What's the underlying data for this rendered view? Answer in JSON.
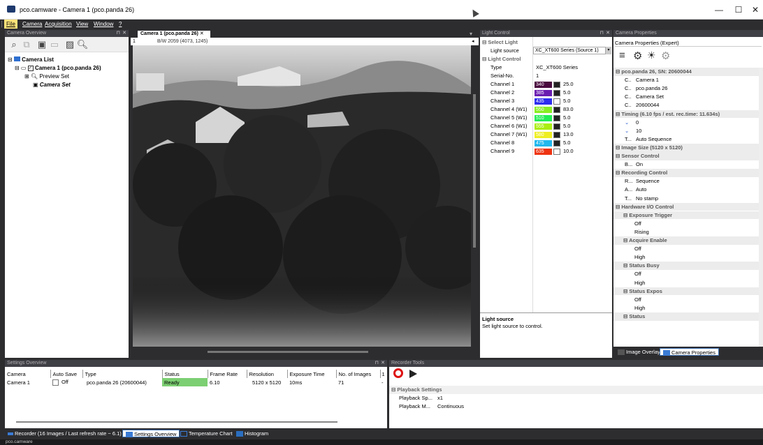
{
  "window": {
    "title": "pco.camware - Camera 1 (pco.panda 26)",
    "min": "—",
    "max": "☐",
    "close": "✕"
  },
  "menu": [
    {
      "label": "File"
    },
    {
      "label": "Camera"
    },
    {
      "label": "Acquisition"
    },
    {
      "label": "View"
    },
    {
      "label": "Window"
    },
    {
      "label": "?"
    }
  ],
  "camera_overview": {
    "title": "Camera Overview",
    "tree": {
      "root": "Camera List",
      "camera": "Camera 1 (pco.panda 26)",
      "preview": "Preview Set",
      "camset": "Camera Set"
    }
  },
  "image_view": {
    "tab": "Camera 1 (pco.panda 26)",
    "info": "B/W  2059 (4073, 1245)",
    "ruler_left": "1"
  },
  "light_control": {
    "title": "Light Control",
    "sections": {
      "select": "Select Light",
      "control": "Light Control"
    },
    "light_source_label": "Light source",
    "light_source_value": "XC_XT600 Series (Source 1)",
    "type_label": "Type",
    "type_value": "XC_XT600 Series",
    "serial_label": "Serial-No.",
    "serial_value": "1",
    "channels": [
      {
        "name": "Channel 1",
        "wl": "340",
        "color": "#4a0a3e",
        "fill": "#222222",
        "value": "25.0"
      },
      {
        "name": "Channel 2",
        "wl": "385",
        "color": "#6a1db0",
        "fill": "#222222",
        "value": "5.0"
      },
      {
        "name": "Channel 3",
        "wl": "435",
        "color": "#2d2dee",
        "fill": "#ffffff",
        "value": "5.0"
      },
      {
        "name": "Channel 4 (W1)",
        "wl": "550",
        "color": "#88ee22",
        "fill": "#222222",
        "value": "83.0"
      },
      {
        "name": "Channel 5 (W1)",
        "wl": "510",
        "color": "#22ee55",
        "fill": "#222222",
        "value": "5.0"
      },
      {
        "name": "Channel 6 (W1)",
        "wl": "555",
        "color": "#aaee11",
        "fill": "#222222",
        "value": "5.0"
      },
      {
        "name": "Channel 7 (W1)",
        "wl": "580",
        "color": "#eeee22",
        "fill": "#222222",
        "value": "13.0"
      },
      {
        "name": "Channel 8",
        "wl": "475",
        "color": "#22b8ee",
        "fill": "#222222",
        "value": "5.0"
      },
      {
        "name": "Channel 9",
        "wl": "635",
        "color": "#ee3311",
        "fill": "#ffffff",
        "value": "10.0"
      }
    ],
    "help_title": "Light source",
    "help_text": "Set light source to control."
  },
  "camera_properties": {
    "title": "Camera Properties",
    "dropdown": "Camera Properties (Expert)",
    "rows": [
      {
        "k": "",
        "v": "pco.panda 26, SN: 20600044",
        "kind": "sect"
      },
      {
        "k": "C..",
        "v": "Camera 1",
        "kind": "row"
      },
      {
        "k": "C..",
        "v": "pco.panda 26",
        "kind": "row"
      },
      {
        "k": "C..",
        "v": "Camera Set",
        "kind": "row"
      },
      {
        "k": "C..",
        "v": "20600044",
        "kind": "row"
      },
      {
        "k": "",
        "v": "Timing (6.10 fps / est. rec.time: 11.634s)",
        "kind": "sect"
      },
      {
        "k": "⌄",
        "v": "0",
        "kind": "row"
      },
      {
        "k": "⌄",
        "v": "10",
        "kind": "row"
      },
      {
        "k": "T...",
        "v": "Auto Sequence",
        "kind": "row"
      },
      {
        "k": "",
        "v": "Image Size (5120 x 5120)",
        "kind": "sect"
      },
      {
        "k": "",
        "v": "Sensor Control",
        "kind": "sect"
      },
      {
        "k": "B...",
        "v": "On",
        "kind": "row"
      },
      {
        "k": "",
        "v": "Recording Control",
        "kind": "sect"
      },
      {
        "k": "R...",
        "v": "Sequence",
        "kind": "row"
      },
      {
        "k": "A...",
        "v": "Auto",
        "kind": "row"
      },
      {
        "k": "T...",
        "v": "No stamp",
        "kind": "row"
      },
      {
        "k": "",
        "v": "Hardware I/O Control",
        "kind": "sect"
      },
      {
        "k": "",
        "v": "Exposure Trigger",
        "kind": "sub"
      },
      {
        "k": "",
        "v": "Off",
        "kind": "val"
      },
      {
        "k": "",
        "v": "Rising",
        "kind": "val"
      },
      {
        "k": "",
        "v": "Acquire Enable",
        "kind": "sub"
      },
      {
        "k": "",
        "v": "Off",
        "kind": "val"
      },
      {
        "k": "",
        "v": "High",
        "kind": "val"
      },
      {
        "k": "",
        "v": "Status Busy",
        "kind": "sub"
      },
      {
        "k": "",
        "v": "Off",
        "kind": "val"
      },
      {
        "k": "",
        "v": "High",
        "kind": "val"
      },
      {
        "k": "",
        "v": "Status Expos",
        "kind": "sub"
      },
      {
        "k": "",
        "v": "Off",
        "kind": "val"
      },
      {
        "k": "",
        "v": "High",
        "kind": "val"
      },
      {
        "k": "",
        "v": "Status",
        "kind": "sub"
      }
    ],
    "tabs": [
      "Image Overlay",
      "Camera Properties"
    ]
  },
  "settings_overview": {
    "title": "Settings Overview",
    "headers": [
      "Camera",
      "Auto Save",
      "Type",
      "Status",
      "Frame Rate",
      "Resolution",
      "Exposure Time",
      "No. of Images",
      "1"
    ],
    "row": {
      "camera": "Camera 1",
      "autosave": "Off",
      "type": "pco.panda 26 (20600044)",
      "status": "Ready",
      "framerate": "6.10",
      "resolution": "5120 x 5120",
      "exposure": "10ms",
      "images": "71",
      "extra": "-"
    }
  },
  "recorder_tools": {
    "title": "Recorder Tools",
    "section": "Playback Settings",
    "rows": [
      {
        "k": "Playback Sp...",
        "v": "x1"
      },
      {
        "k": "Playback M...",
        "v": "Continuous"
      }
    ]
  },
  "bottom_tabs": [
    "Recorder (16 Images / Last refresh rate ~ 6.1)",
    "Settings Overview",
    "Temperature Chart",
    "Histogram"
  ],
  "statusbar": "pco.camware",
  "colors": {
    "ready": "#7ccf72",
    "accent": "#3c6fb0"
  }
}
